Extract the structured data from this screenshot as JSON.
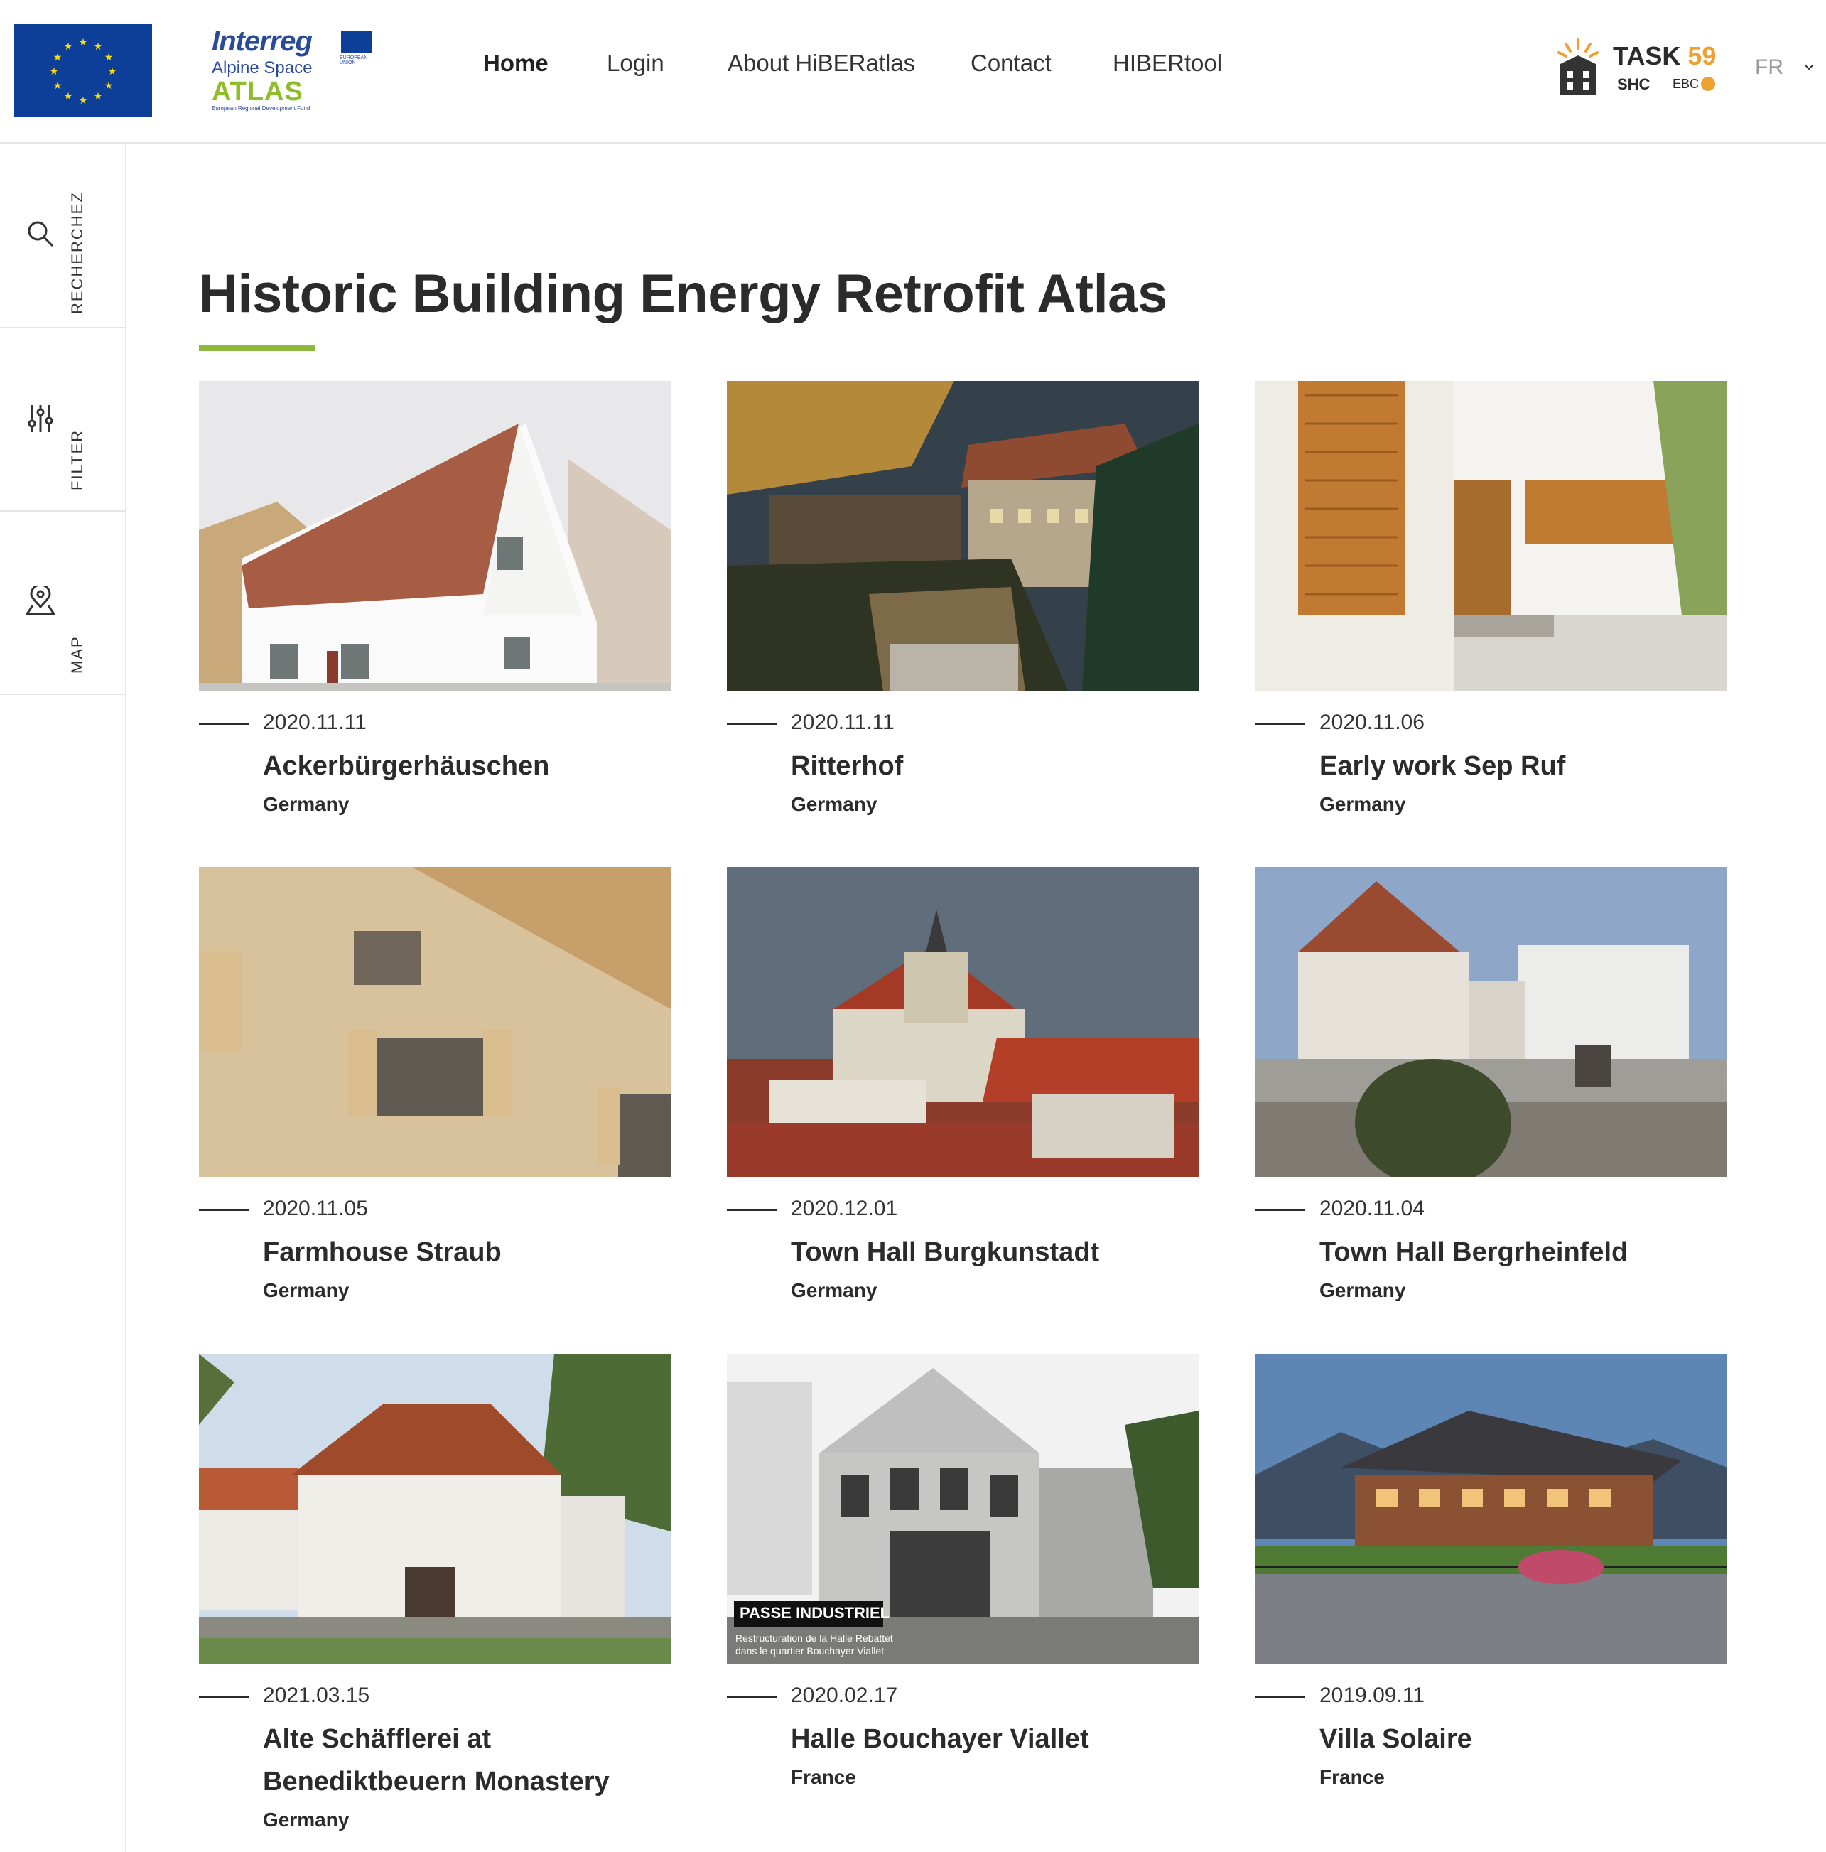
{
  "header": {
    "interreg": {
      "name": "Interreg",
      "subtitle": "Alpine Space",
      "atlas": "ATLAS",
      "fund_note": "European Regional Development Fund",
      "eu_label": "EUROPEAN UNION"
    },
    "nav": [
      {
        "label": "Home",
        "active": true
      },
      {
        "label": "Login",
        "active": false
      },
      {
        "label": "About HiBERatlas",
        "active": false
      },
      {
        "label": "Contact",
        "active": false
      },
      {
        "label": "HIBERtool",
        "active": false
      }
    ],
    "task_logo": {
      "task": "TASK",
      "number": "59",
      "shc": "SHC",
      "ebc": "EBC"
    },
    "language": "FR"
  },
  "sidebar": {
    "items": [
      {
        "label": "RECHERCHEZ",
        "icon": "search-icon"
      },
      {
        "label": "FILTER",
        "icon": "sliders-icon"
      },
      {
        "label": "MAP",
        "icon": "map-pin-icon"
      }
    ]
  },
  "main": {
    "title": "Historic Building Energy Retrofit Atlas",
    "accent_color": "#8dba3c",
    "cards": [
      {
        "date": "2020.11.11",
        "title": "Ackerbürgerhäuschen",
        "country": "Germany"
      },
      {
        "date": "2020.11.11",
        "title": "Ritterhof",
        "country": "Germany"
      },
      {
        "date": "2020.11.06",
        "title": "Early work Sep Ruf",
        "country": "Germany"
      },
      {
        "date": "2020.11.05",
        "title": "Farmhouse Straub",
        "country": "Germany"
      },
      {
        "date": "2020.12.01",
        "title": "Town Hall Burgkunstadt",
        "country": "Germany"
      },
      {
        "date": "2020.11.04",
        "title": "Town Hall Bergrheinfeld",
        "country": "Germany"
      },
      {
        "date": "2021.03.15",
        "title": "Alte Schäfflerei at Benediktbeuern Monastery",
        "country": "Germany"
      },
      {
        "date": "2020.02.17",
        "title": "Halle Bouchayer Viallet",
        "country": "France",
        "image_caption": "PASSE INDUSTRIEL",
        "image_subcaption_1": "Restructuration de la Halle Rebattet",
        "image_subcaption_2": "dans le quartier Bouchayer Viallet"
      },
      {
        "date": "2019.09.11",
        "title": "Villa Solaire",
        "country": "France"
      }
    ]
  }
}
